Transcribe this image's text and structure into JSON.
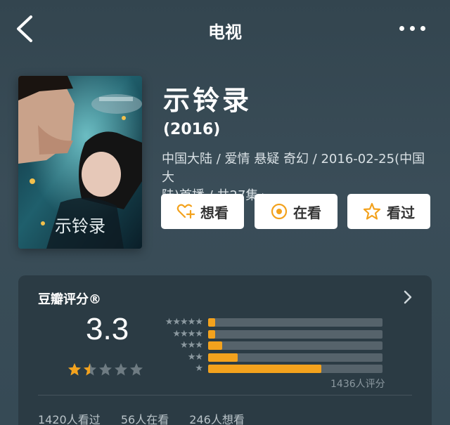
{
  "nav": {
    "title": "电视"
  },
  "show": {
    "title": "示铃录",
    "year": "(2016)",
    "meta_line1": "中国大陆 / 爱情 悬疑 奇幻 / 2016-02-25(中国大",
    "meta_line2": "陆)首播 / 共27集",
    "meta_chevron": "›"
  },
  "actions": {
    "want": "想看",
    "watching": "在看",
    "watched": "看过"
  },
  "rating": {
    "label": "豆瓣评分®",
    "score": "3.3",
    "star_value": 1.5,
    "total": "1436人评分",
    "distribution": [
      {
        "stars": "★★★★★",
        "fraction": 0.04
      },
      {
        "stars": "★★★★",
        "fraction": 0.04
      },
      {
        "stars": "★★★",
        "fraction": 0.08
      },
      {
        "stars": "★★",
        "fraction": 0.17
      },
      {
        "stars": "★",
        "fraction": 0.65
      }
    ],
    "watched": "1420人看过",
    "watching": "56人在看",
    "want": "246人想看"
  },
  "colors": {
    "accent": "#f3a21d",
    "card": "#2b3b44",
    "background": "#3a4d58"
  },
  "icons": {
    "back": "chevron-left-icon",
    "more": "more-dots-icon",
    "want": "heart-plus-icon",
    "watching": "target-icon",
    "watched": "star-outline-icon"
  }
}
